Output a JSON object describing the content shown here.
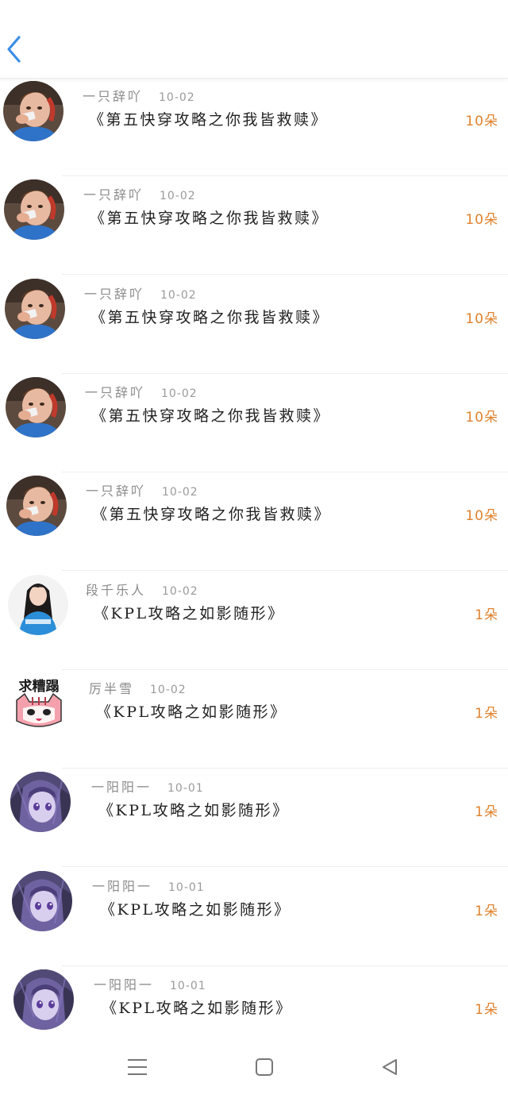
{
  "header": {
    "back_icon": "chevron-left-icon",
    "accent_color": "#3a8ee6"
  },
  "records": [
    {
      "user": "一只辞吖",
      "date": "10-02",
      "title": "《第五快穿攻略之你我皆救赎》",
      "count": "10朵",
      "avatar": "photo-man-headset"
    },
    {
      "user": "一只辞吖",
      "date": "10-02",
      "title": "《第五快穿攻略之你我皆救赎》",
      "count": "10朵",
      "avatar": "photo-man-headset"
    },
    {
      "user": "一只辞吖",
      "date": "10-02",
      "title": "《第五快穿攻略之你我皆救赎》",
      "count": "10朵",
      "avatar": "photo-man-headset"
    },
    {
      "user": "一只辞吖",
      "date": "10-02",
      "title": "《第五快穿攻略之你我皆救赎》",
      "count": "10朵",
      "avatar": "photo-man-headset"
    },
    {
      "user": "一只辞吖",
      "date": "10-02",
      "title": "《第五快穿攻略之你我皆救赎》",
      "count": "10朵",
      "avatar": "photo-man-headset"
    },
    {
      "user": "段千乐人",
      "date": "10-02",
      "title": "《KPL攻略之如影随形》",
      "count": "1朵",
      "avatar": "photo-girl-blue"
    },
    {
      "user": "厉半雪",
      "date": "10-02",
      "title": "《KPL攻略之如影随形》",
      "count": "1朵",
      "avatar": "cartoon-cat",
      "avatar_text": "求糟蹋"
    },
    {
      "user": "一阳阳一",
      "date": "10-01",
      "title": "《KPL攻略之如影随形》",
      "count": "1朵",
      "avatar": "anime-purple"
    },
    {
      "user": "一阳阳一",
      "date": "10-01",
      "title": "《KPL攻略之如影随形》",
      "count": "1朵",
      "avatar": "anime-purple"
    },
    {
      "user": "一阳阳一",
      "date": "10-01",
      "title": "《KPL攻略之如影随形》",
      "count": "1朵",
      "avatar": "anime-purple"
    }
  ],
  "navbar": {
    "menu_icon": "menu-icon",
    "home_icon": "square-home-icon",
    "back_icon": "triangle-back-icon"
  },
  "colors": {
    "count": "#e0822e",
    "meta": "#8a8a8a",
    "title": "#222222"
  }
}
